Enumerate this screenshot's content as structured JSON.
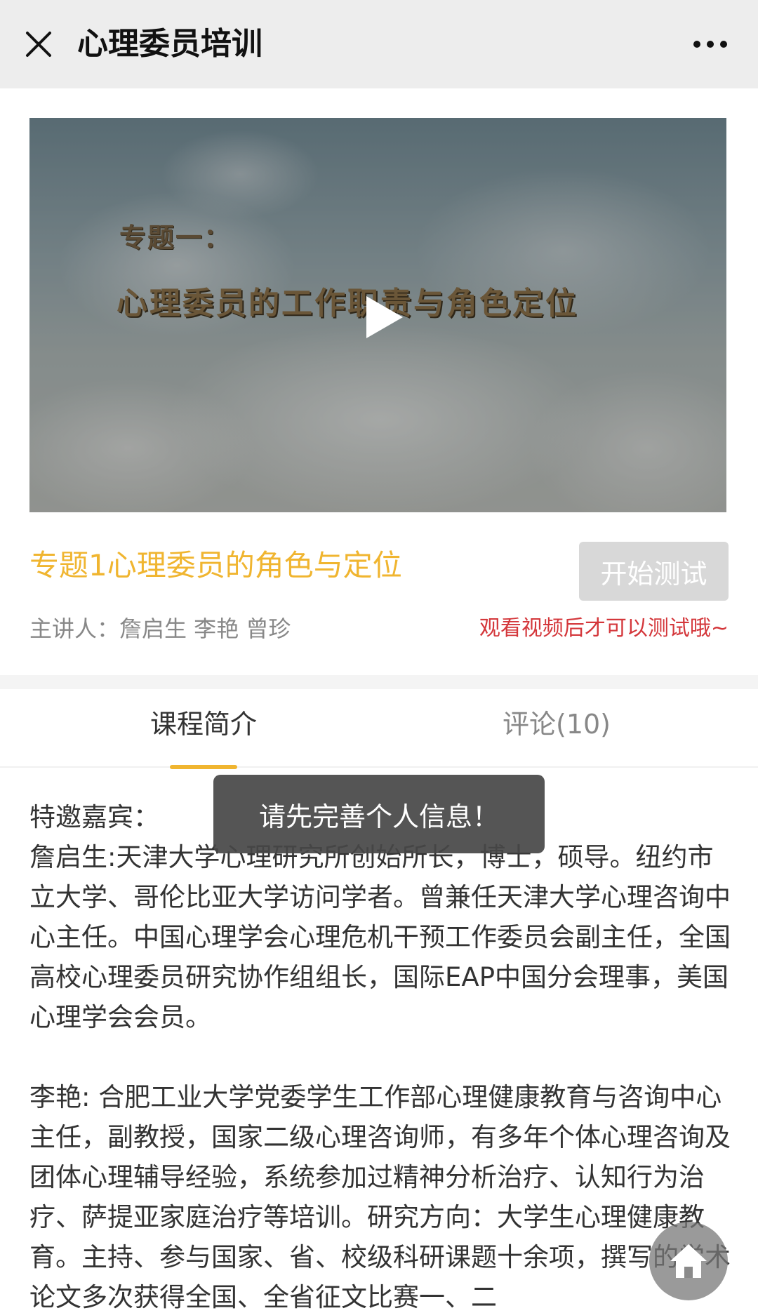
{
  "navbar": {
    "title": "心理委员培训",
    "close_icon": "close-icon",
    "more_icon": "more-dots-icon"
  },
  "video": {
    "subtitle": "专题一：",
    "headline": "心理委员的工作职责与角色定位",
    "play_icon": "play-icon"
  },
  "course": {
    "title": "专题1心理委员的角色与定位",
    "test_button": "开始测试",
    "lecturer": "主讲人：詹启生 李艳 曾珍",
    "notice": "观看视频后才可以测试哦~"
  },
  "tabs": [
    {
      "label": "课程简介",
      "active": true
    },
    {
      "label": "评论(10)",
      "active": false
    }
  ],
  "intro": {
    "heading": "特邀嘉宾：",
    "paragraphs": [
      "詹启生:天津大学心理研究所创始所长，博士，硕导。纽约市立大学、哥伦比亚大学访问学者。曾兼任天津大学心理咨询中心主任。中国心理学会心理危机干预工作委员会副主任，全国高校心理委员研究协作组组长，国际EAP中国分会理事，美国心理学会会员。",
      "李艳: 合肥工业大学党委学生工作部心理健康教育与咨询中心主任，副教授，国家二级心理咨询师，有多年个体心理咨询及团体心理辅导经验，系统参加过精神分析治疗、认知行为治疗、萨提亚家庭治疗等培训。研究方向：大学生心理健康教育。主持、参与国家、省、校级科研课题十余项，撰写的学术论文多次获得全国、全省征文比赛一、二"
    ]
  },
  "toast": "请先完善个人信息！",
  "home_icon": "home-icon",
  "colors": {
    "accent": "#f0b530",
    "notice": "#d4373b",
    "navbar_bg": "#ededed",
    "disabled_button": "#d8d8d8"
  }
}
